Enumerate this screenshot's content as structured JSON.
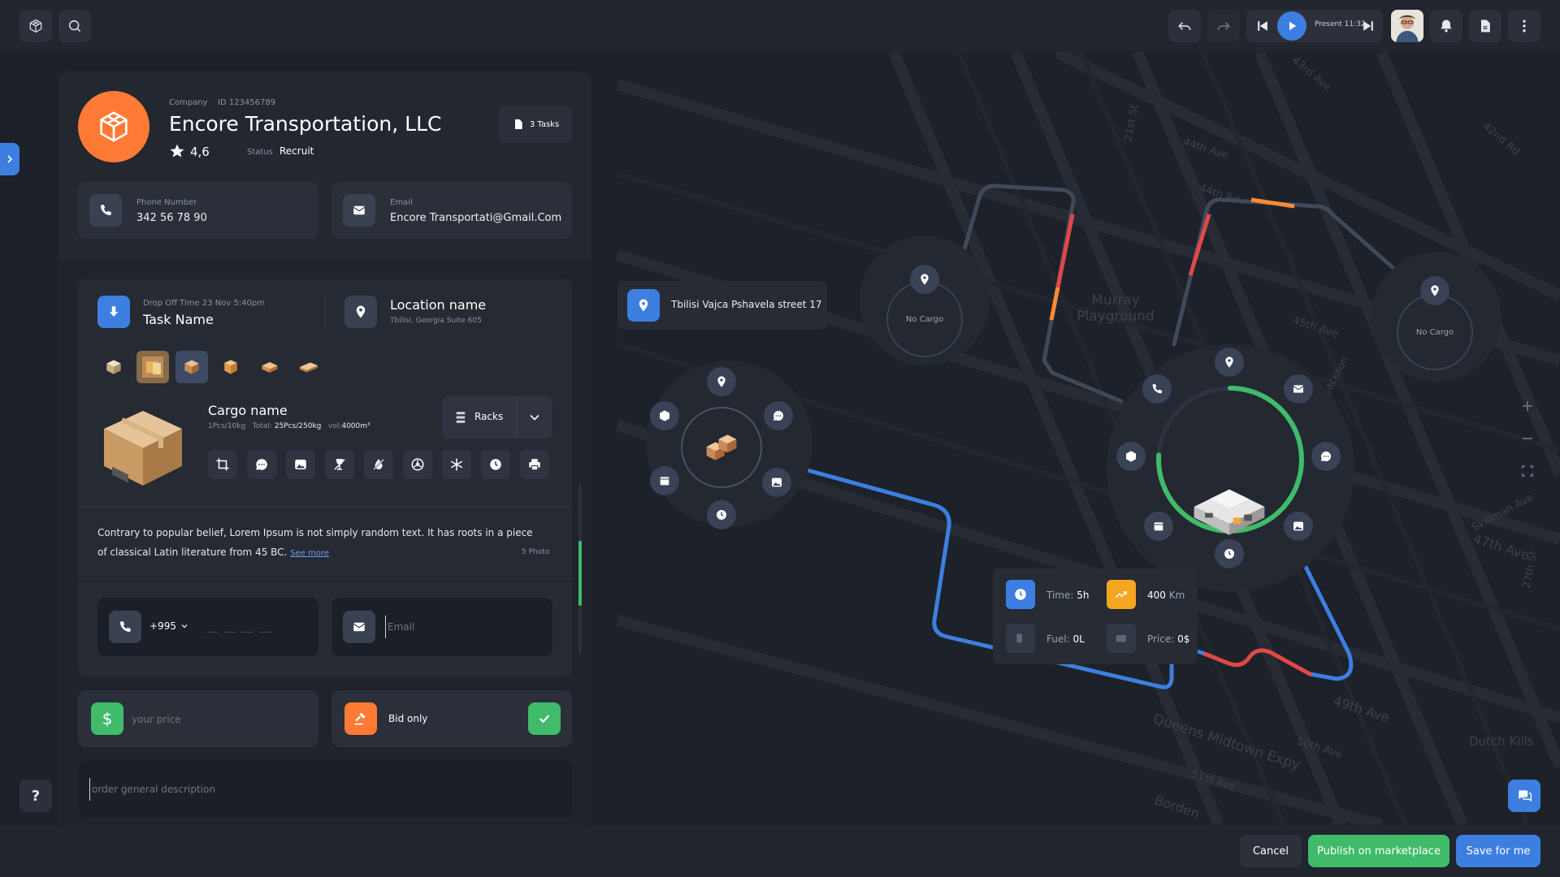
{
  "header": {
    "present_label": "Present 11:32"
  },
  "company": {
    "label": "Company",
    "id": "ID 123456789",
    "name": "Encore Transportation, LLC",
    "rating": "4,6",
    "status_label": "Status",
    "status_value": "Recruit",
    "tasks_label": "3 Tasks"
  },
  "contacts": {
    "phone_label": "Phone Number",
    "phone_value": "342 56 78 90",
    "email_label": "Email",
    "email_value": "Encore Transportati@Gmail.Com"
  },
  "task": {
    "dropoff_label": "Drop Off Time",
    "dropoff_value": "23 Nov 5:40pm",
    "name": "Task Name",
    "location_title": "Location name",
    "location_sub": "Tbilisi, Georgia Suite 605"
  },
  "cargo": {
    "name": "Cargo name",
    "pcs": "1Pcs/10kg",
    "total_label": "Total:",
    "total_value": "25Pcs/250kg",
    "vol_label": "vol:",
    "vol_value": "4000m³",
    "racks_label": "Racks",
    "description": "Contrary to popular belief, Lorem Ipsum is not simply random text. It has roots in a piece of classical Latin literature from 45 BC.",
    "see_more": "See more",
    "photos": "5 Photo"
  },
  "form": {
    "country_code": "+995",
    "phone_placeholder": "__ __ __ __",
    "email_placeholder": "Email",
    "price_placeholder": "your price",
    "bid_label": "Bid only",
    "description_placeholder": "order general description"
  },
  "map": {
    "address": "Tbilisi Vajca Pshavela street 17",
    "no_cargo_1": "No Cargo",
    "no_cargo_2": "No Cargo",
    "time_label": "Time:",
    "time_value": "5h",
    "km_value": "400",
    "km_unit": "Km",
    "fuel_label": "Fuel:",
    "fuel_value": "0L",
    "price_label": "Price:",
    "price_value": "0$",
    "streets": [
      "Murray Playground",
      "43rd Ave",
      "44th Ave",
      "44th Rd",
      "42nd Rd",
      "45th Ave",
      "47th Ave",
      "49th Ave",
      "Queens Midtown Expy",
      "Dutch Kills",
      "Skillman Ave",
      "51st Ave",
      "Borden",
      "50th Ave",
      "21st St",
      "27th St",
      "Jackson"
    ]
  },
  "footer": {
    "cancel": "Cancel",
    "publish": "Publish on marketplace",
    "save": "Save for me"
  },
  "colors": {
    "accent_orange": "#ff7a35",
    "accent_blue": "#3d7fe0",
    "accent_green": "#3fbb6a",
    "route_red": "#e04848"
  }
}
